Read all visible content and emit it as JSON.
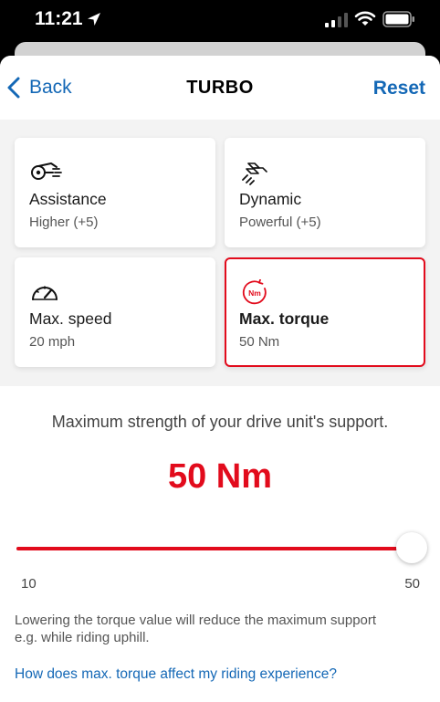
{
  "status_bar": {
    "time": "11:21",
    "icons": [
      "location-arrow-icon",
      "cellular-signal-icon",
      "wifi-icon",
      "battery-icon"
    ]
  },
  "nav": {
    "back_label": "Back",
    "title": "TURBO",
    "reset_label": "Reset"
  },
  "cards": [
    {
      "icon": "assistance-icon",
      "title": "Assistance",
      "value": "Higher (+5)",
      "selected": false
    },
    {
      "icon": "dynamic-icon",
      "title": "Dynamic",
      "value": "Powerful (+5)",
      "selected": false
    },
    {
      "icon": "speedometer-icon",
      "title": "Max. speed",
      "value": "20 mph",
      "selected": false
    },
    {
      "icon": "torque-icon",
      "title": "Max. torque",
      "value": "50 Nm",
      "selected": true
    }
  ],
  "detail": {
    "description": "Maximum strength of your drive unit's support.",
    "current_value": "50 Nm",
    "slider": {
      "min": 10,
      "max": 50,
      "value": 50,
      "min_label": "10",
      "max_label": "50"
    },
    "note": "Lowering the torque value will reduce the maximum support e.g. while riding uphill.",
    "help_link": "How does max. torque affect my riding experience?"
  },
  "colors": {
    "accent": "#e20b1c",
    "link": "#1468b6",
    "background_panel": "#f3f3f3"
  }
}
